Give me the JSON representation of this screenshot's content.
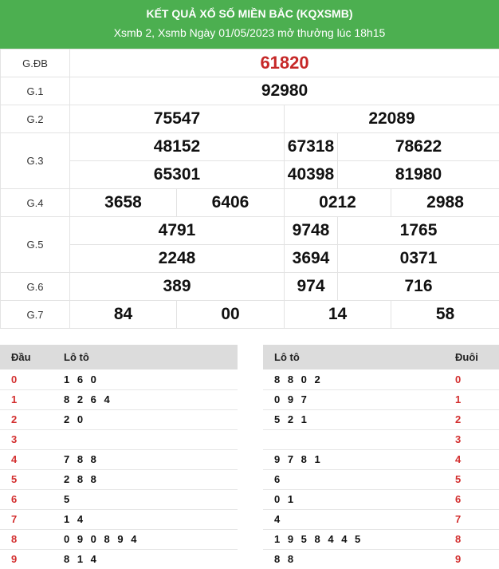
{
  "header": {
    "title": "KẾT QUẢ XỔ SỐ MIỀN BẮC (KQXSMB)",
    "subtitle": "Xsmb 2, Xsmb Ngày 01/05/2023 mở thưởng lúc 18h15"
  },
  "prizes": {
    "gdb": {
      "label": "G.ĐB",
      "numbers": [
        "61820"
      ]
    },
    "g1": {
      "label": "G.1",
      "numbers": [
        "92980"
      ]
    },
    "g2": {
      "label": "G.2",
      "numbers": [
        "75547",
        "22089"
      ]
    },
    "g3": {
      "label": "G.3",
      "numbers": [
        "48152",
        "67318",
        "78622",
        "65301",
        "40398",
        "81980"
      ]
    },
    "g4": {
      "label": "G.4",
      "numbers": [
        "3658",
        "6406",
        "0212",
        "2988"
      ]
    },
    "g5": {
      "label": "G.5",
      "numbers": [
        "4791",
        "9748",
        "1765",
        "2248",
        "3694",
        "0371"
      ]
    },
    "g6": {
      "label": "G.6",
      "numbers": [
        "389",
        "974",
        "716"
      ]
    },
    "g7": {
      "label": "G.7",
      "numbers": [
        "84",
        "00",
        "14",
        "58"
      ]
    }
  },
  "loto_head": {
    "col_dau": "Đầu",
    "col_loto": "Lô tô",
    "rows": [
      {
        "digit": "0",
        "values": "1 6 0"
      },
      {
        "digit": "1",
        "values": "8 2 6 4"
      },
      {
        "digit": "2",
        "values": "2 0"
      },
      {
        "digit": "3",
        "values": ""
      },
      {
        "digit": "4",
        "values": "7 8 8"
      },
      {
        "digit": "5",
        "values": "2 8 8"
      },
      {
        "digit": "6",
        "values": "5"
      },
      {
        "digit": "7",
        "values": "1 4"
      },
      {
        "digit": "8",
        "values": "0 9 0 8 9 4"
      },
      {
        "digit": "9",
        "values": "8 1 4"
      }
    ]
  },
  "loto_tail": {
    "col_loto": "Lô tô",
    "col_duoi": "Đuôi",
    "rows": [
      {
        "digit": "0",
        "values": "8 8 0 2"
      },
      {
        "digit": "1",
        "values": "0 9 7"
      },
      {
        "digit": "2",
        "values": "5 2 1"
      },
      {
        "digit": "3",
        "values": ""
      },
      {
        "digit": "4",
        "values": "9 7 8 1"
      },
      {
        "digit": "5",
        "values": "6"
      },
      {
        "digit": "6",
        "values": "0 1"
      },
      {
        "digit": "7",
        "values": "4"
      },
      {
        "digit": "8",
        "values": "1 9 5 8 4 4 5"
      },
      {
        "digit": "9",
        "values": "8 8"
      }
    ]
  }
}
